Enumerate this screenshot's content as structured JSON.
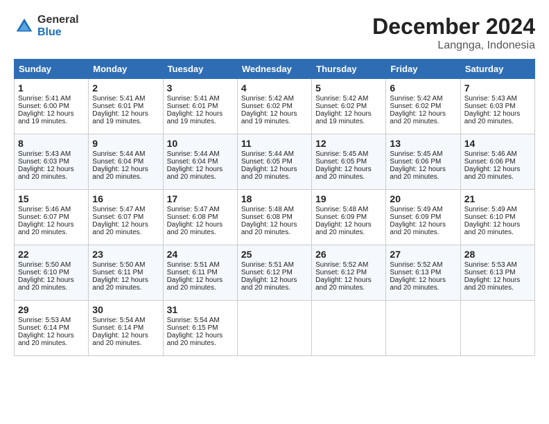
{
  "header": {
    "logo_general": "General",
    "logo_blue": "Blue",
    "month_year": "December 2024",
    "location": "Langnga, Indonesia"
  },
  "days_of_week": [
    "Sunday",
    "Monday",
    "Tuesday",
    "Wednesday",
    "Thursday",
    "Friday",
    "Saturday"
  ],
  "weeks": [
    [
      {
        "day": "1",
        "sunrise": "Sunrise: 5:41 AM",
        "sunset": "Sunset: 6:00 PM",
        "daylight": "Daylight: 12 hours and 19 minutes."
      },
      {
        "day": "2",
        "sunrise": "Sunrise: 5:41 AM",
        "sunset": "Sunset: 6:01 PM",
        "daylight": "Daylight: 12 hours and 19 minutes."
      },
      {
        "day": "3",
        "sunrise": "Sunrise: 5:41 AM",
        "sunset": "Sunset: 6:01 PM",
        "daylight": "Daylight: 12 hours and 19 minutes."
      },
      {
        "day": "4",
        "sunrise": "Sunrise: 5:42 AM",
        "sunset": "Sunset: 6:02 PM",
        "daylight": "Daylight: 12 hours and 19 minutes."
      },
      {
        "day": "5",
        "sunrise": "Sunrise: 5:42 AM",
        "sunset": "Sunset: 6:02 PM",
        "daylight": "Daylight: 12 hours and 19 minutes."
      },
      {
        "day": "6",
        "sunrise": "Sunrise: 5:42 AM",
        "sunset": "Sunset: 6:02 PM",
        "daylight": "Daylight: 12 hours and 20 minutes."
      },
      {
        "day": "7",
        "sunrise": "Sunrise: 5:43 AM",
        "sunset": "Sunset: 6:03 PM",
        "daylight": "Daylight: 12 hours and 20 minutes."
      }
    ],
    [
      {
        "day": "8",
        "sunrise": "Sunrise: 5:43 AM",
        "sunset": "Sunset: 6:03 PM",
        "daylight": "Daylight: 12 hours and 20 minutes."
      },
      {
        "day": "9",
        "sunrise": "Sunrise: 5:44 AM",
        "sunset": "Sunset: 6:04 PM",
        "daylight": "Daylight: 12 hours and 20 minutes."
      },
      {
        "day": "10",
        "sunrise": "Sunrise: 5:44 AM",
        "sunset": "Sunset: 6:04 PM",
        "daylight": "Daylight: 12 hours and 20 minutes."
      },
      {
        "day": "11",
        "sunrise": "Sunrise: 5:44 AM",
        "sunset": "Sunset: 6:05 PM",
        "daylight": "Daylight: 12 hours and 20 minutes."
      },
      {
        "day": "12",
        "sunrise": "Sunrise: 5:45 AM",
        "sunset": "Sunset: 6:05 PM",
        "daylight": "Daylight: 12 hours and 20 minutes."
      },
      {
        "day": "13",
        "sunrise": "Sunrise: 5:45 AM",
        "sunset": "Sunset: 6:06 PM",
        "daylight": "Daylight: 12 hours and 20 minutes."
      },
      {
        "day": "14",
        "sunrise": "Sunrise: 5:46 AM",
        "sunset": "Sunset: 6:06 PM",
        "daylight": "Daylight: 12 hours and 20 minutes."
      }
    ],
    [
      {
        "day": "15",
        "sunrise": "Sunrise: 5:46 AM",
        "sunset": "Sunset: 6:07 PM",
        "daylight": "Daylight: 12 hours and 20 minutes."
      },
      {
        "day": "16",
        "sunrise": "Sunrise: 5:47 AM",
        "sunset": "Sunset: 6:07 PM",
        "daylight": "Daylight: 12 hours and 20 minutes."
      },
      {
        "day": "17",
        "sunrise": "Sunrise: 5:47 AM",
        "sunset": "Sunset: 6:08 PM",
        "daylight": "Daylight: 12 hours and 20 minutes."
      },
      {
        "day": "18",
        "sunrise": "Sunrise: 5:48 AM",
        "sunset": "Sunset: 6:08 PM",
        "daylight": "Daylight: 12 hours and 20 minutes."
      },
      {
        "day": "19",
        "sunrise": "Sunrise: 5:48 AM",
        "sunset": "Sunset: 6:09 PM",
        "daylight": "Daylight: 12 hours and 20 minutes."
      },
      {
        "day": "20",
        "sunrise": "Sunrise: 5:49 AM",
        "sunset": "Sunset: 6:09 PM",
        "daylight": "Daylight: 12 hours and 20 minutes."
      },
      {
        "day": "21",
        "sunrise": "Sunrise: 5:49 AM",
        "sunset": "Sunset: 6:10 PM",
        "daylight": "Daylight: 12 hours and 20 minutes."
      }
    ],
    [
      {
        "day": "22",
        "sunrise": "Sunrise: 5:50 AM",
        "sunset": "Sunset: 6:10 PM",
        "daylight": "Daylight: 12 hours and 20 minutes."
      },
      {
        "day": "23",
        "sunrise": "Sunrise: 5:50 AM",
        "sunset": "Sunset: 6:11 PM",
        "daylight": "Daylight: 12 hours and 20 minutes."
      },
      {
        "day": "24",
        "sunrise": "Sunrise: 5:51 AM",
        "sunset": "Sunset: 6:11 PM",
        "daylight": "Daylight: 12 hours and 20 minutes."
      },
      {
        "day": "25",
        "sunrise": "Sunrise: 5:51 AM",
        "sunset": "Sunset: 6:12 PM",
        "daylight": "Daylight: 12 hours and 20 minutes."
      },
      {
        "day": "26",
        "sunrise": "Sunrise: 5:52 AM",
        "sunset": "Sunset: 6:12 PM",
        "daylight": "Daylight: 12 hours and 20 minutes."
      },
      {
        "day": "27",
        "sunrise": "Sunrise: 5:52 AM",
        "sunset": "Sunset: 6:13 PM",
        "daylight": "Daylight: 12 hours and 20 minutes."
      },
      {
        "day": "28",
        "sunrise": "Sunrise: 5:53 AM",
        "sunset": "Sunset: 6:13 PM",
        "daylight": "Daylight: 12 hours and 20 minutes."
      }
    ],
    [
      {
        "day": "29",
        "sunrise": "Sunrise: 5:53 AM",
        "sunset": "Sunset: 6:14 PM",
        "daylight": "Daylight: 12 hours and 20 minutes."
      },
      {
        "day": "30",
        "sunrise": "Sunrise: 5:54 AM",
        "sunset": "Sunset: 6:14 PM",
        "daylight": "Daylight: 12 hours and 20 minutes."
      },
      {
        "day": "31",
        "sunrise": "Sunrise: 5:54 AM",
        "sunset": "Sunset: 6:15 PM",
        "daylight": "Daylight: 12 hours and 20 minutes."
      },
      null,
      null,
      null,
      null
    ]
  ]
}
